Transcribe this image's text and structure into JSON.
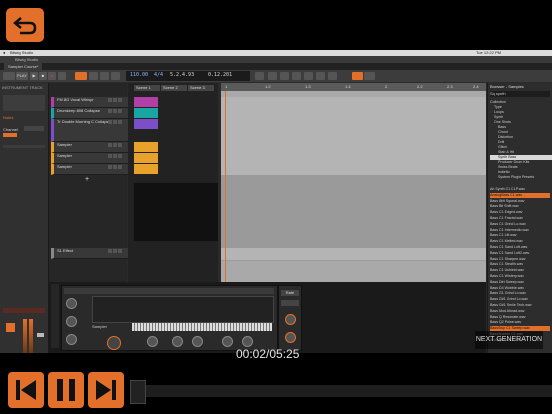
{
  "app": {
    "mac_menu_left": "Bitwig Studio",
    "mac_menu_right": "Tue 12:22 PM",
    "title": "Bitwig Studio",
    "tab": "Sampler Course*"
  },
  "toolbar": {
    "play_label": "PLAY",
    "lcd_tempo": "110.00",
    "lcd_sig": "4/4",
    "lcd_pos1": "5.2.4.93",
    "lcd_pos2": "0.12.201"
  },
  "inspector": {
    "header": "INSTRUMENT TRACK",
    "label_notes": "Notes",
    "label_channel": "Channel"
  },
  "tracks": [
    {
      "name": "FM 8G Vocal Whispr"
    },
    {
      "name": "Drumkeep 808 Collapse"
    },
    {
      "name": "Tr Double Morning C Collapse"
    },
    {
      "name": "Sampler"
    },
    {
      "name": "Sampler"
    },
    {
      "name": "Sampler"
    }
  ],
  "scenes": [
    "Scene 1",
    "Scene 2",
    "Scene 3"
  ],
  "effect_track": "S1 Effect",
  "ruler": [
    "1",
    "1.2",
    "1.3",
    "1.4",
    "2",
    "2.2",
    "2.3",
    "2.4"
  ],
  "browser": {
    "title": "Browser - Samples",
    "search": "Sq synth",
    "items": [
      "Collection",
      "Type",
      "Loops",
      "Synth",
      "One Shots",
      "Bass",
      "Chord",
      "Distortion",
      "Drill",
      "Glitch",
      "Stab & Hit",
      "Synth Bass",
      "Producer Drum Kits",
      "Swiss Beats",
      "Indiefio",
      "System Plugin Presets"
    ],
    "files": [
      "Ah Synth C1 CLP.wav",
      "AnalogBass C1.wav",
      "Bass 8bit Squeal.wav",
      "Bass Bit Shift.wav",
      "Bass C1 Edged.wav",
      "Bass C1 Fractal.wav",
      "Bass C1 Grind Lo.wav",
      "Bass C1 Intermedio.wav",
      "Bass C1 Lilt.wav",
      "Bass C1 Melted.wav",
      "Bass C1 Sand Loft.wav",
      "Bass C1 Sand Loft2.wav",
      "Bass C1 Sharpen.wav",
      "Bass C1 Stealth.wav",
      "Bass C1 Ushield.wav",
      "Bass C1 Wintery.wav",
      "Bass Dirt Sweep.wav",
      "Bass D4 Wobble.wav",
      "Bass G1 Grind Lo.wav",
      "Bass G#1 Grind Lo.wav",
      "Bass G#1 Smile Tech.wav",
      "Bass Mod Ahead.wav",
      "Bass Q Resonate.wav",
      "Bass Q2 Pulse.wav",
      "BassSwp C1 Sweep.wav",
      "BassWobble C1.wav",
      "AnalogBass C1.wav"
    ]
  },
  "device": {
    "track_label": "Sampler",
    "keys_label": "C3",
    "side_button": "Rate"
  },
  "player": {
    "timecode": "00:02/05:25",
    "progress": 0.006,
    "watermark": "NEXT GENERATION"
  },
  "colors": {
    "accent": "#e3702a",
    "clip_magenta": "#b03fa8",
    "clip_teal": "#1aa6a0",
    "clip_orange": "#e8a22c",
    "clip_purple": "#7a4fc8"
  }
}
